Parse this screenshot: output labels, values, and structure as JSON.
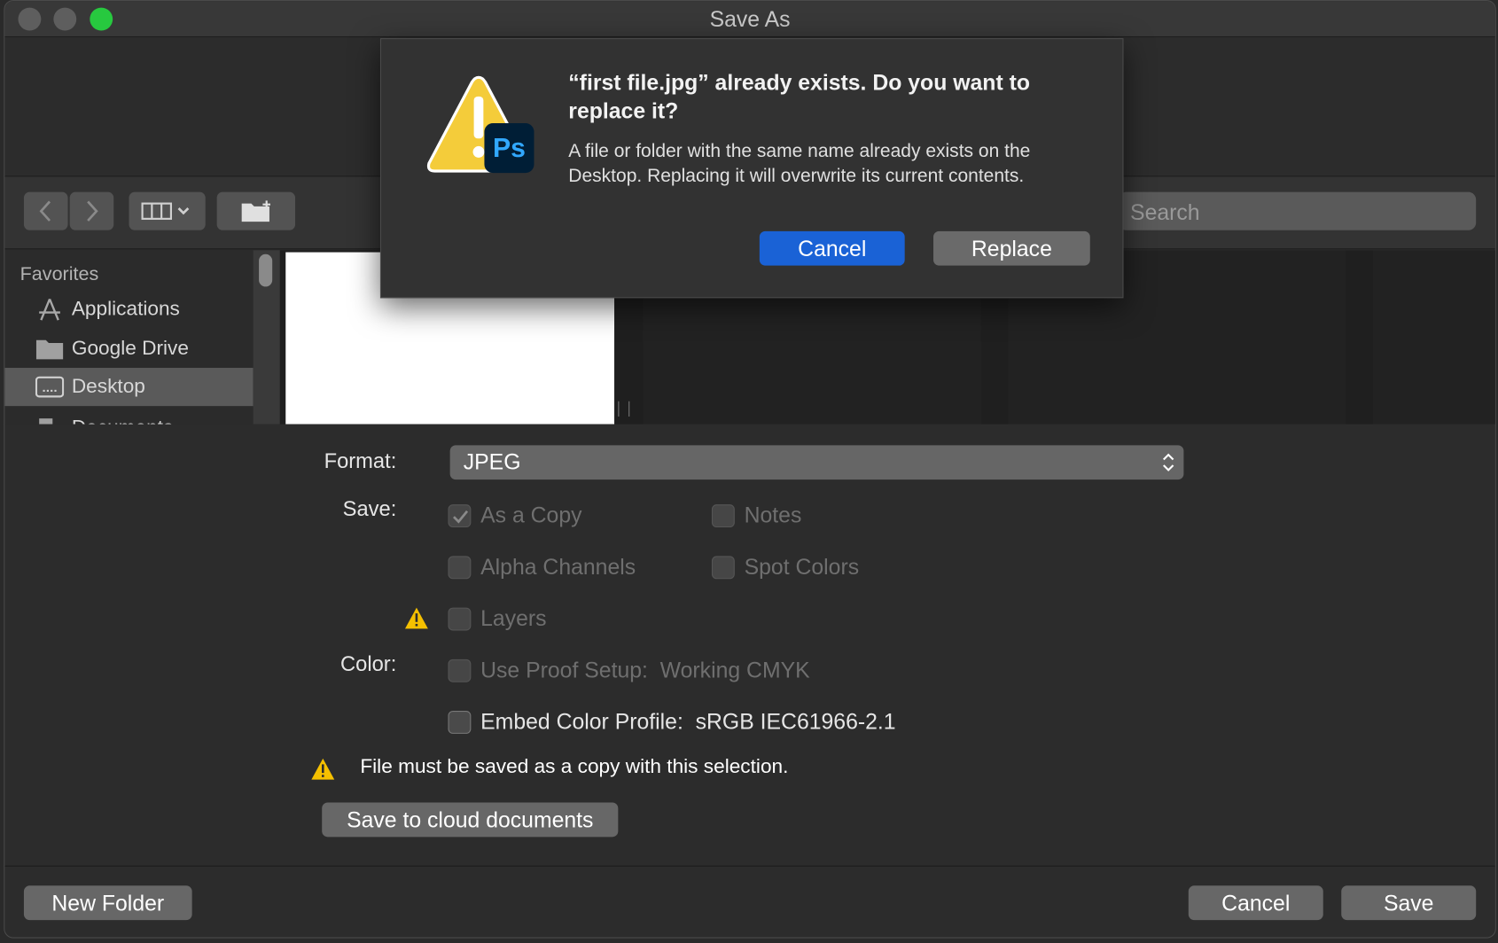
{
  "window": {
    "title": "Save As"
  },
  "toolbar": {
    "search_placeholder": "Search"
  },
  "sidebar": {
    "heading": "Favorites",
    "items": [
      {
        "label": "Applications",
        "icon": "applications-icon"
      },
      {
        "label": "Google Drive",
        "icon": "folder-icon"
      },
      {
        "label": "Desktop",
        "icon": "desktop-icon",
        "selected": true
      },
      {
        "label": "Documents",
        "icon": "documents-icon"
      }
    ]
  },
  "options": {
    "format_label": "Format:",
    "format_value": "JPEG",
    "save_label": "Save:",
    "color_label": "Color:",
    "checkboxes": {
      "as_a_copy": {
        "label": "As a Copy",
        "checked": true,
        "enabled": false
      },
      "notes": {
        "label": "Notes",
        "checked": false,
        "enabled": false
      },
      "alpha_channels": {
        "label": "Alpha Channels",
        "checked": false,
        "enabled": false
      },
      "spot_colors": {
        "label": "Spot Colors",
        "checked": false,
        "enabled": false
      },
      "layers": {
        "label": "Layers",
        "checked": false,
        "enabled": false
      },
      "use_proof_setup": {
        "label": "Use Proof Setup:  Working CMYK",
        "checked": false,
        "enabled": false
      },
      "embed_color_profile": {
        "label": "Embed Color Profile:  sRGB IEC61966-2.1",
        "checked": false,
        "enabled": true
      }
    },
    "warning_text": "File must be saved as a copy with this selection.",
    "cloud_button": "Save to cloud documents"
  },
  "footer": {
    "new_folder": "New Folder",
    "cancel": "Cancel",
    "save": "Save"
  },
  "alert": {
    "title": "“first file.jpg” already exists. Do you want to replace it?",
    "message": "A file or folder with the same name already exists on the Desktop. Replacing it will overwrite its current contents.",
    "badge": "Ps",
    "cancel": "Cancel",
    "replace": "Replace"
  },
  "colors": {
    "accent": "#1a62d6",
    "warning": "#f5c000",
    "ps_badge_bg": "#001e36",
    "ps_badge_text": "#31a8ff"
  }
}
